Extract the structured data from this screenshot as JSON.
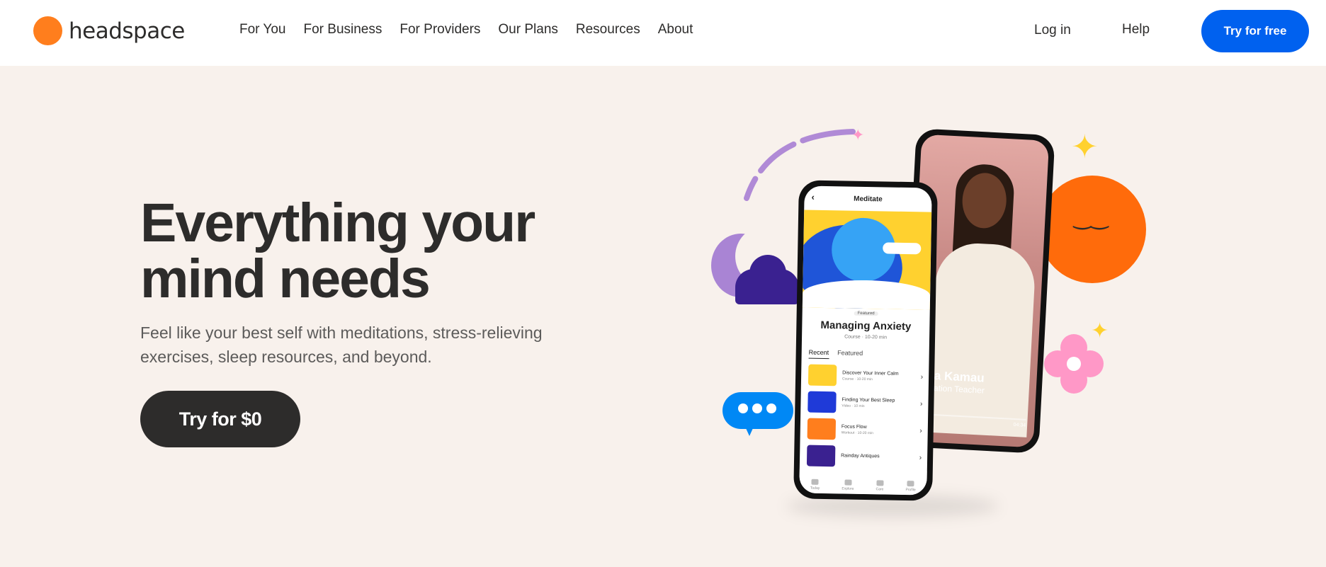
{
  "header": {
    "brand": "headspace",
    "nav": [
      "For You",
      "For Business",
      "For Providers",
      "Our Plans",
      "Resources",
      "About"
    ],
    "login": "Log in",
    "help": "Help",
    "cta": "Try for free"
  },
  "hero": {
    "title": "Everything your mind needs",
    "subtitle": "Feel like your best self with meditations, stress-relieving exercises, sleep resources, and beyond.",
    "cta": "Try for $0"
  },
  "app_screen": {
    "header_title": "Meditate",
    "back": "‹",
    "featured_pill": "Featured",
    "feature_title": "Managing Anxiety",
    "feature_meta": "Course · 10-20 min",
    "tabs": [
      "Recent",
      "Featured"
    ],
    "items": [
      {
        "title": "Discover Your Inner Calm",
        "meta": "Course · 10-20 min",
        "color": "#ffd12f"
      },
      {
        "title": "Finding Your Best Sleep",
        "meta": "Video · 10 min",
        "color": "#1f3ad8"
      },
      {
        "title": "Focus Flow",
        "meta": "Workout · 10-20 min",
        "color": "#ff7e1d"
      },
      {
        "title": "Rainday Antiques",
        "meta": "",
        "color": "#3a2190"
      }
    ],
    "bottom_nav": [
      "Today",
      "Explore",
      "Care",
      "Profile"
    ]
  },
  "video_screen": {
    "name": "Dora Kamau",
    "role": "Meditation Teacher",
    "time": "04:34",
    "progress": 0.16
  },
  "colors": {
    "brand_orange": "#ff7e1d",
    "cta_blue": "#0061ef",
    "dark": "#2d2c2b",
    "hero_bg": "#f8f1ec"
  },
  "icons": {
    "logo": "orange-circle",
    "chevron": "›",
    "sun_face": "‿‿"
  }
}
